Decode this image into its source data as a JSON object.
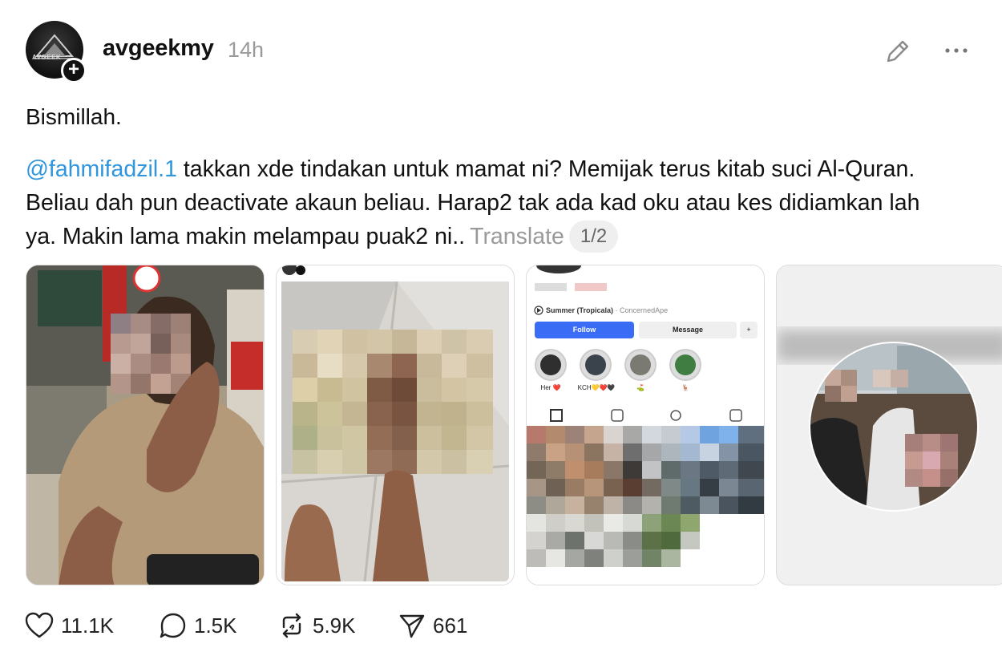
{
  "post": {
    "username": "avgeekmy",
    "time": "14h",
    "avatar_text": "AVGEEK",
    "line1": "Bismillah.",
    "mention": "@fahmifadzil.1",
    "body": " takkan xde tindakan untuk mamat ni? Memijak terus kitab suci Al-Quran. Beliau dah pun deactivate akaun beliau. Harap2 tak ada kad oku atau kes didiamkan lah ya. Makin lama makin melampau puak2 ni..",
    "translate_label": "Translate",
    "page_indicator": "1/2"
  },
  "screenshot": {
    "song": "Summer (Tropicala)",
    "artist": "· ConcernedApe",
    "follow_label": "Follow",
    "message_label": "Message",
    "highlights": [
      "Her ❤️",
      "KCH💛❤️🖤",
      "⛳",
      "🦌"
    ]
  },
  "stats": {
    "likes": "11.1K",
    "replies": "1.5K",
    "reposts": "5.9K",
    "shares": "661"
  },
  "colors": {
    "mention": "#2f95dc",
    "muted": "#9a9a9a",
    "follow_button": "#3b6cf6"
  }
}
